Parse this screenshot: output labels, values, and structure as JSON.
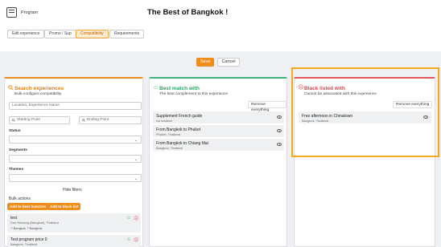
{
  "header": {
    "program_label": "Program",
    "title": "The Best of Bangkok !",
    "tabs": [
      "Edit experience",
      "Promo / Sup",
      "Compatibility",
      "Requirements"
    ],
    "active_tab": "Compatibility"
  },
  "actions": {
    "save_label": "Save",
    "cancel_label": "Cancel"
  },
  "search": {
    "title": "Search experiences",
    "subtitle": "Bulk-configure compatibility",
    "location_placeholder": "Location, Experience Name",
    "starting_point_placeholder": "Starting Point",
    "ending_point_placeholder": "Ending Point",
    "status_label": "Status",
    "segments_label": "Segments",
    "themes_label": "Themes",
    "hide_filters": "Hide filters",
    "bulk_actions_label": "Bulk actions",
    "add_best_label": "Add to best matches",
    "add_black_label": "Add to black list",
    "results": [
      {
        "title": "test",
        "subtitle": "Don Mueang (Bangkok), Thailand",
        "tags": [
          "Bangkok",
          "Bangkok"
        ]
      },
      {
        "title": "Test program price 0",
        "subtitle": "Bangkok, Thailand"
      }
    ]
  },
  "best": {
    "title": "Best match with",
    "subtitle": "The best complement to this experience",
    "remove_all": "Remove everything",
    "items": [
      {
        "title": "Supplement French guide",
        "subtitle": "No location"
      },
      {
        "title": "From Bangkok to Phuket",
        "subtitle": "Phuket, Thailand"
      },
      {
        "title": "From Bangkok to Chiang Mai",
        "subtitle": "Bangkok, Thailand"
      }
    ]
  },
  "black": {
    "title": "Black listed with",
    "subtitle": "Cannot be associated with this experience",
    "remove_all": "Remove everything",
    "items": [
      {
        "title": "Free afternoon in Chinatown",
        "subtitle": "Bangkok, Thailand"
      }
    ]
  },
  "colors": {
    "accent": "#f08c1a",
    "best": "#3bb37a",
    "black": "#e0545a",
    "highlight": "#f2a91e"
  }
}
